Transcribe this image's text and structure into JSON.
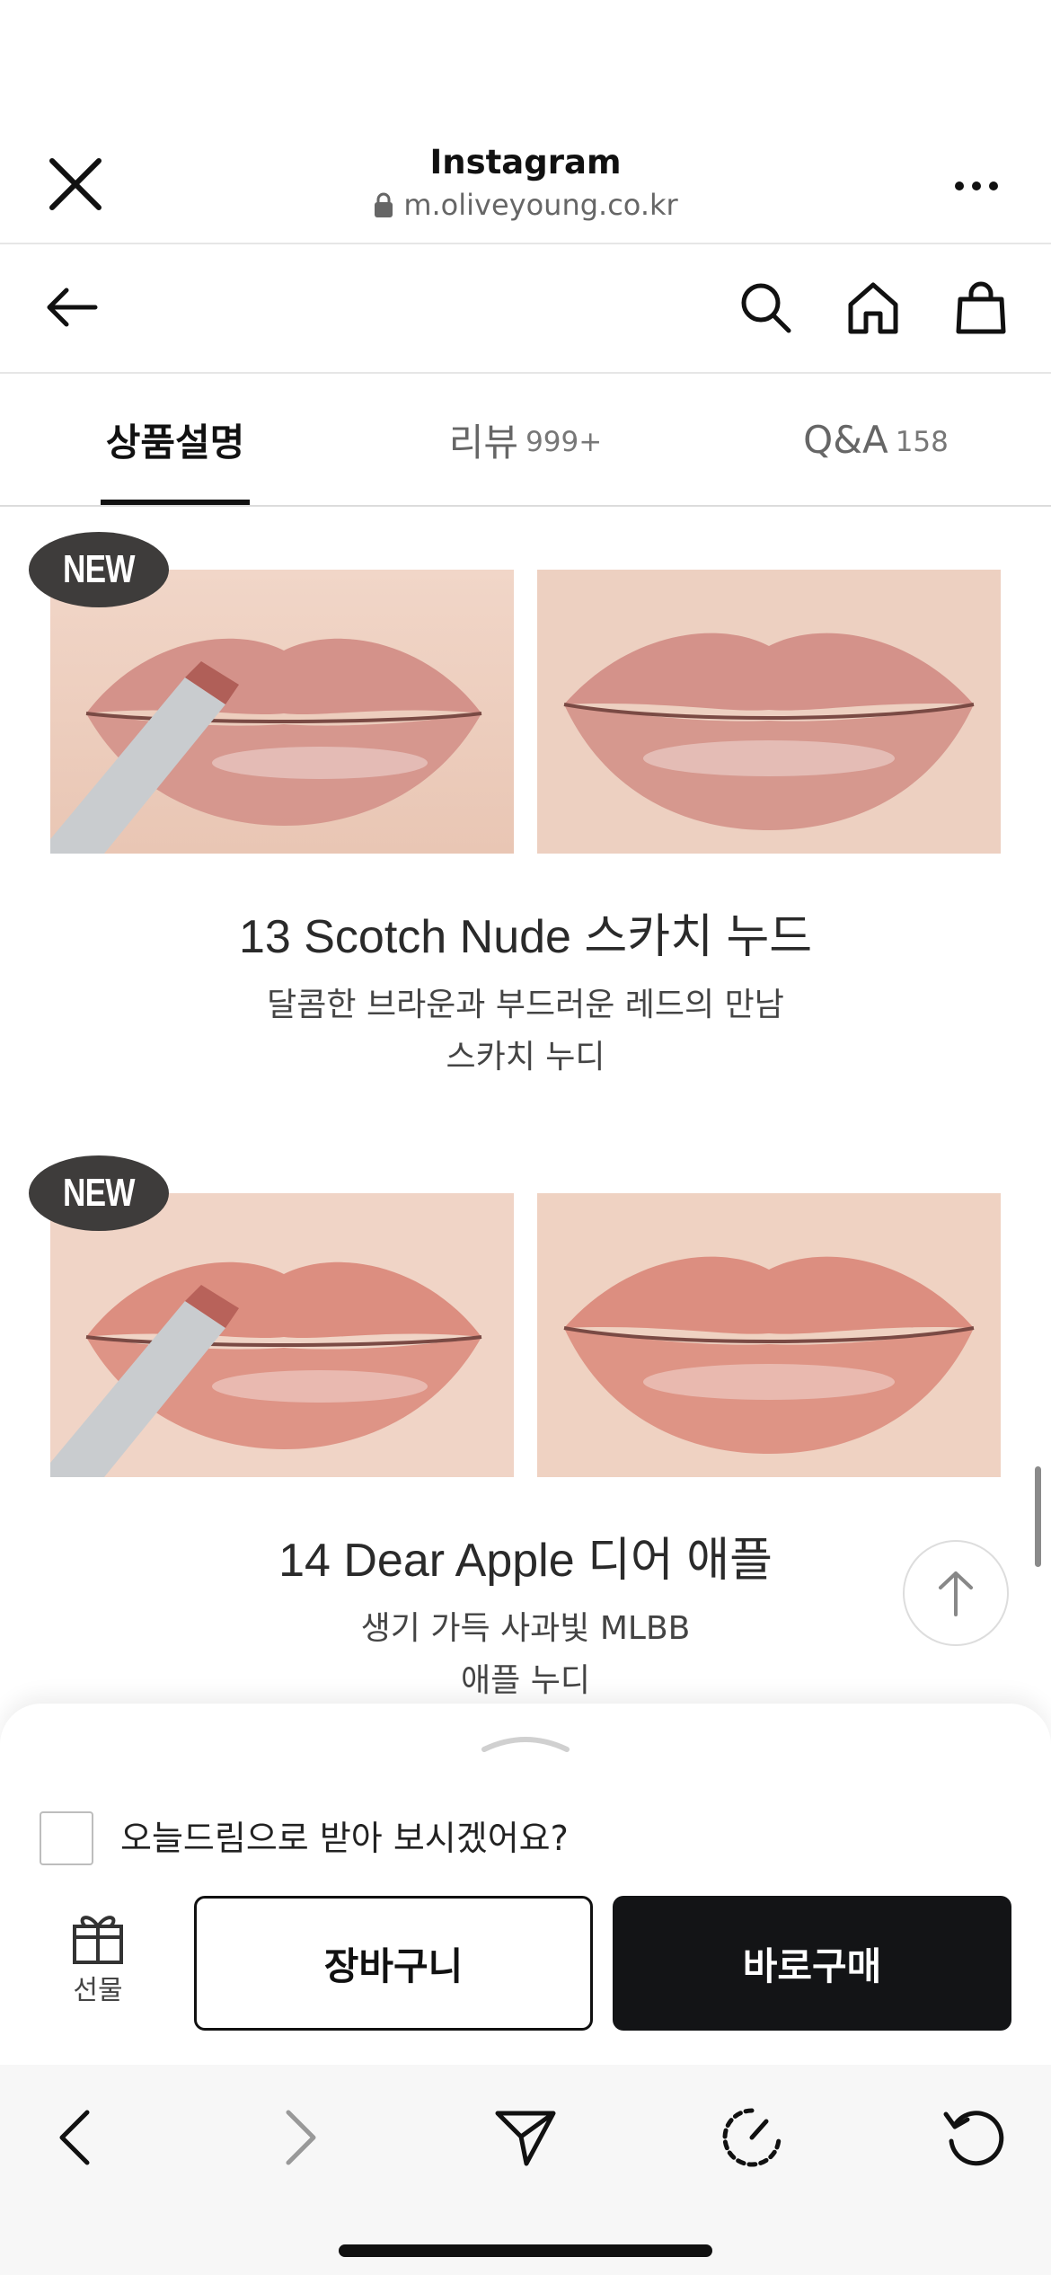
{
  "browser": {
    "app_title": "Instagram",
    "url": "m.oliveyoung.co.kr",
    "icons": [
      "close-icon",
      "lock-icon",
      "more-icon"
    ]
  },
  "nav": {
    "icons": [
      "back-arrow-icon",
      "search-icon",
      "home-icon",
      "shopping-bag-icon"
    ]
  },
  "tabs": [
    {
      "label": "상품설명",
      "count": "",
      "active": true
    },
    {
      "label": "리뷰",
      "count": "999+",
      "active": false
    },
    {
      "label": "Q&A",
      "count": "158",
      "active": false
    }
  ],
  "products": [
    {
      "badge": "NEW",
      "name": "13 Scotch Nude 스카치 누드",
      "desc_line1": "달콤한 브라운과 부드러운 레드의 만남",
      "desc_line2": "스카치 누디",
      "lip_color": "#d4928a"
    },
    {
      "badge": "NEW",
      "name": "14 Dear Apple 디어 애플",
      "desc_line1": "생기 가득 사과빛 MLBB",
      "desc_line2": "애플 누디",
      "lip_color": "#dc8e80"
    }
  ],
  "sheet": {
    "checkbox_label": "오늘드림으로 받아 보시겠어요?",
    "checkbox_checked": false,
    "gift_label": "선물",
    "cart_label": "장바구니",
    "buy_label": "바로구매",
    "buy_color": "#131416"
  },
  "toolbar": {
    "icons": [
      "back-icon",
      "forward-icon",
      "share-send-icon",
      "speed-icon",
      "reload-icon"
    ]
  }
}
